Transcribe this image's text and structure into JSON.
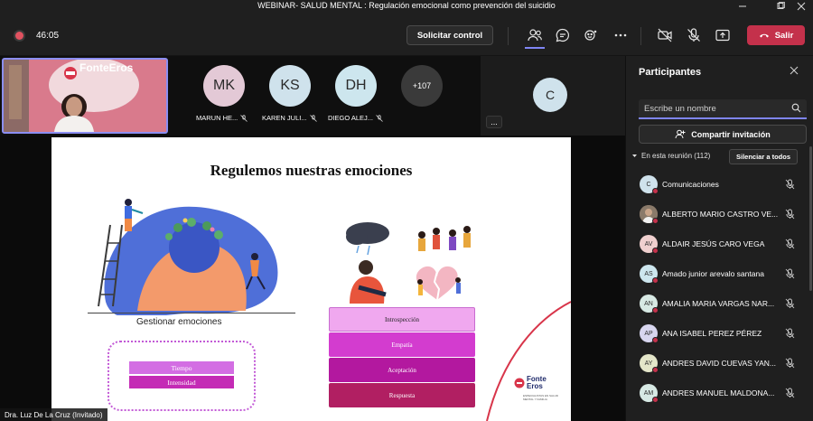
{
  "window": {
    "title": "WEBINAR- SALUD MENTAL : Regulación emocional como prevención del suicidio",
    "controls": [
      "minimize-icon",
      "maximize-icon",
      "close-icon"
    ]
  },
  "toolbar": {
    "timer": "46:05",
    "request_control": "Solicitar control",
    "leave": "Salir",
    "icons": [
      "people-icon",
      "chat-icon",
      "reactions-icon",
      "more-icon",
      "camera-off-icon",
      "mic-off-icon",
      "share-icon"
    ],
    "leave_color": "#c4314b",
    "accent": "#7f85f5"
  },
  "gallery": {
    "presenter_brand": "FonteEros",
    "participants": [
      {
        "initials": "MK",
        "name": "MARUN HE...",
        "color": "#e3c9d6"
      },
      {
        "initials": "KS",
        "name": "KAREN JULI...",
        "color": "#cfe2ec"
      },
      {
        "initials": "DH",
        "name": "DIEGO ALEJ...",
        "color": "#cde6ee"
      }
    ],
    "more_count": "+107",
    "extra_initial": "C",
    "more_options": "..."
  },
  "slide": {
    "title": "Regulemos nuestras emociones",
    "left_label": "Gestionar emociones",
    "left_bars": [
      "Tiempo",
      "Intensidad"
    ],
    "right_bars": [
      "Introspección",
      "Empatía",
      "Aceptación",
      "Respuesta"
    ],
    "brand": "Fonte Eros",
    "brand_sub": "ESPECIALISTAS EN SALUD MENTAL Y FAMILIA"
  },
  "presenter_label": "Dra. Luz De La Cruz (Invitado)",
  "panel": {
    "title": "Participantes",
    "search_placeholder": "Escribe un nombre",
    "share_invite": "Compartir invitación",
    "meeting_header": "En esta reunión (112)",
    "mute_all": "Silenciar a todos",
    "participants": [
      {
        "initials": "C",
        "name": "Comunicaciones",
        "color": "#cfe2ec",
        "photo": false
      },
      {
        "initials": "",
        "name": "ALBERTO MARIO CASTRO VE...",
        "color": "#8a7a6a",
        "photo": true
      },
      {
        "initials": "AV",
        "name": "ALDAIR JESÚS CARO VEGA",
        "color": "#f0d0cf",
        "photo": false
      },
      {
        "initials": "AS",
        "name": "Amado junior arevalo santana",
        "color": "#cde6ee",
        "photo": false
      },
      {
        "initials": "AN",
        "name": "AMALIA MARIA VARGAS NAR...",
        "color": "#d7e9e4",
        "photo": false
      },
      {
        "initials": "AP",
        "name": "ANA ISABEL PEREZ PÉREZ",
        "color": "#d8d6ef",
        "photo": false
      },
      {
        "initials": "AY",
        "name": "ANDRES DAVID CUEVAS YAN...",
        "color": "#e4e6c9",
        "photo": false
      },
      {
        "initials": "AM",
        "name": "ANDRES MANUEL MALDONA...",
        "color": "#d7e9e4",
        "photo": false
      }
    ]
  }
}
